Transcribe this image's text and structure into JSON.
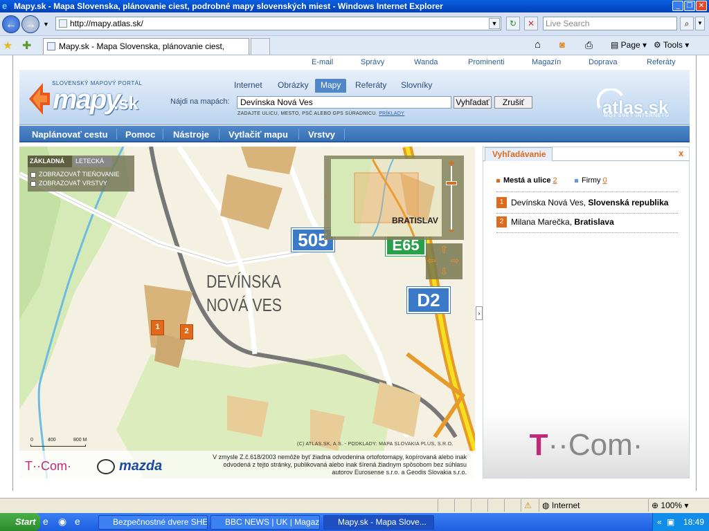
{
  "window": {
    "title": "Mapy.sk - Mapa Slovenska, plánovanie ciest, podrobné mapy slovenských miest - Windows Internet Explorer"
  },
  "browser": {
    "url": "http://mapy.atlas.sk/",
    "search_placeholder": "Live Search",
    "tab_title": "Mapy.sk - Mapa Slovenska, plánovanie ciest, podrobn...",
    "page_label": "Page",
    "tools_label": "Tools"
  },
  "top_links": [
    "E-mail",
    "Správy",
    "Wanda",
    "Prominenti",
    "Magazín",
    "Doprava",
    "Referáty"
  ],
  "header": {
    "logo_tagline": "SLOVENSKÝ MAPOVÝ PORTÁL",
    "logo_text": "mapy",
    "logo_suffix": ".sk",
    "search_tabs": [
      "Internet",
      "Obrázky",
      "Mapy",
      "Referáty",
      "Slovníky"
    ],
    "active_tab": "Mapy",
    "finder_label": "Nájdi na mapách:",
    "finder_value": "Devínska Nová Ves",
    "search_button": "Vyhľadať",
    "cancel_button": "Zrušiť",
    "hint": "ZADAJTE ULICU, MESTO, PSČ ALEBO GPS SÚRADNICU.",
    "hint_link": "PRÍKLADY",
    "atlas_logo": "atlas.sk",
    "atlas_tagline": "MÔJ SVET INTERNETU"
  },
  "menu": [
    "Naplánovať cestu",
    "Pomoc",
    "Nástroje",
    "Vytlačiť mapu",
    "Vrstvy"
  ],
  "map": {
    "type_tabs": [
      "ZÁKLADNÁ",
      "LETECKÁ"
    ],
    "options": [
      "ZOBRAZOVAŤ TIEŇOVANIE",
      "ZOBRAZOVAŤ VRSTVY"
    ],
    "place_label_1": "DEVÍNSKA",
    "place_label_2": "NOVÁ VES",
    "road_505": "505",
    "road_e65": "E65",
    "road_d2": "D2",
    "overview_label": "BRATISLAV",
    "pins": [
      "1",
      "2"
    ],
    "scale_labels": [
      "0",
      "400",
      "800 M"
    ],
    "copyright": "(C) ATLAS.SK, A.S. - PODKLADY: MAPA SLOVAKIA PLUS, S.R.O.",
    "legal": "V zmysle Z.č.618/2003 nemôže byť žiadna odvodenina ortofotomapy, kopírovaná alebo inak odvodená z tejto stránky, publikovaná alebo inak šírená žiadnym spôsobom bez súhlasu autorov Eurosense s.r.o. a Geodis Slovakia s.r.o.",
    "sponsor_1": "T··Com·",
    "sponsor_2": "mazda"
  },
  "sidebar": {
    "tab": "Vyhľadávanie",
    "close": "x",
    "filter_cities": "Mestá a ulice",
    "filter_cities_count": "2",
    "filter_firms": "Firmy",
    "filter_firms_count": "0",
    "results": [
      {
        "num": "1",
        "name": "Devínska Nová Ves, ",
        "region": "Slovenská republika"
      },
      {
        "num": "2",
        "name": "Milana Marečka, ",
        "region": "Bratislava"
      }
    ],
    "brand_t": "T",
    "brand_com": "··Com·"
  },
  "statusbar": {
    "zone": "Internet",
    "zoom": "100%"
  },
  "taskbar": {
    "start": "Start",
    "tasks": [
      "Bezpečnostné dvere SHE...",
      "BBC NEWS | UK | Magazi...",
      "Mapy.sk - Mapa Slove..."
    ],
    "clock": "18:49"
  },
  "colors": {
    "accent_blue": "#3670b4",
    "accent_orange": "#e06a1a",
    "tcom_magenta": "#c0297a"
  }
}
